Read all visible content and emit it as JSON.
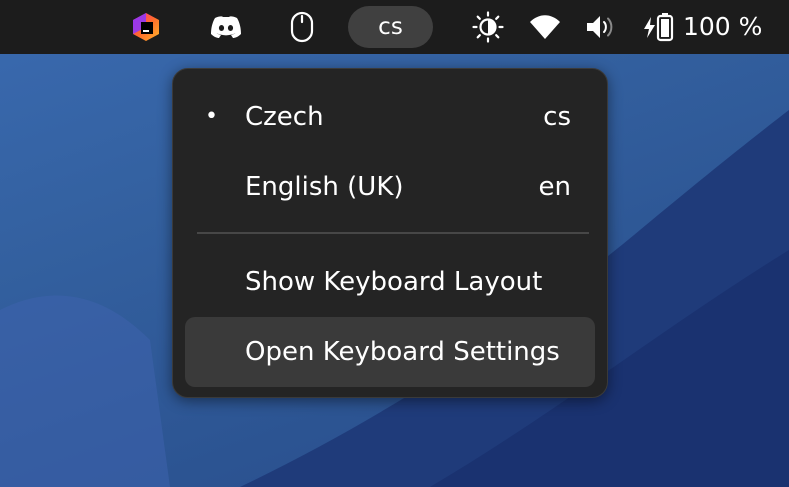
{
  "topbar": {
    "keyboard_indicator": "cs",
    "battery_percent": "100 %",
    "icons": [
      "jetbrains-toolbox-icon",
      "discord-icon",
      "mouse-icon",
      "brightness-icon",
      "wifi-icon",
      "volume-icon",
      "battery-charging-icon"
    ]
  },
  "menu": {
    "items": [
      {
        "bullet": "•",
        "label": "Czech",
        "code": "cs"
      },
      {
        "bullet": "",
        "label": "English (UK)",
        "code": "en"
      },
      {
        "label": "Show Keyboard Layout"
      },
      {
        "label": "Open Keyboard Settings"
      }
    ]
  },
  "colors": {
    "topbar": "#1c1c1c",
    "menu_background": "#242424",
    "menu_hover": "#3a3a3a",
    "wallpaper": "#2f5aa0"
  }
}
